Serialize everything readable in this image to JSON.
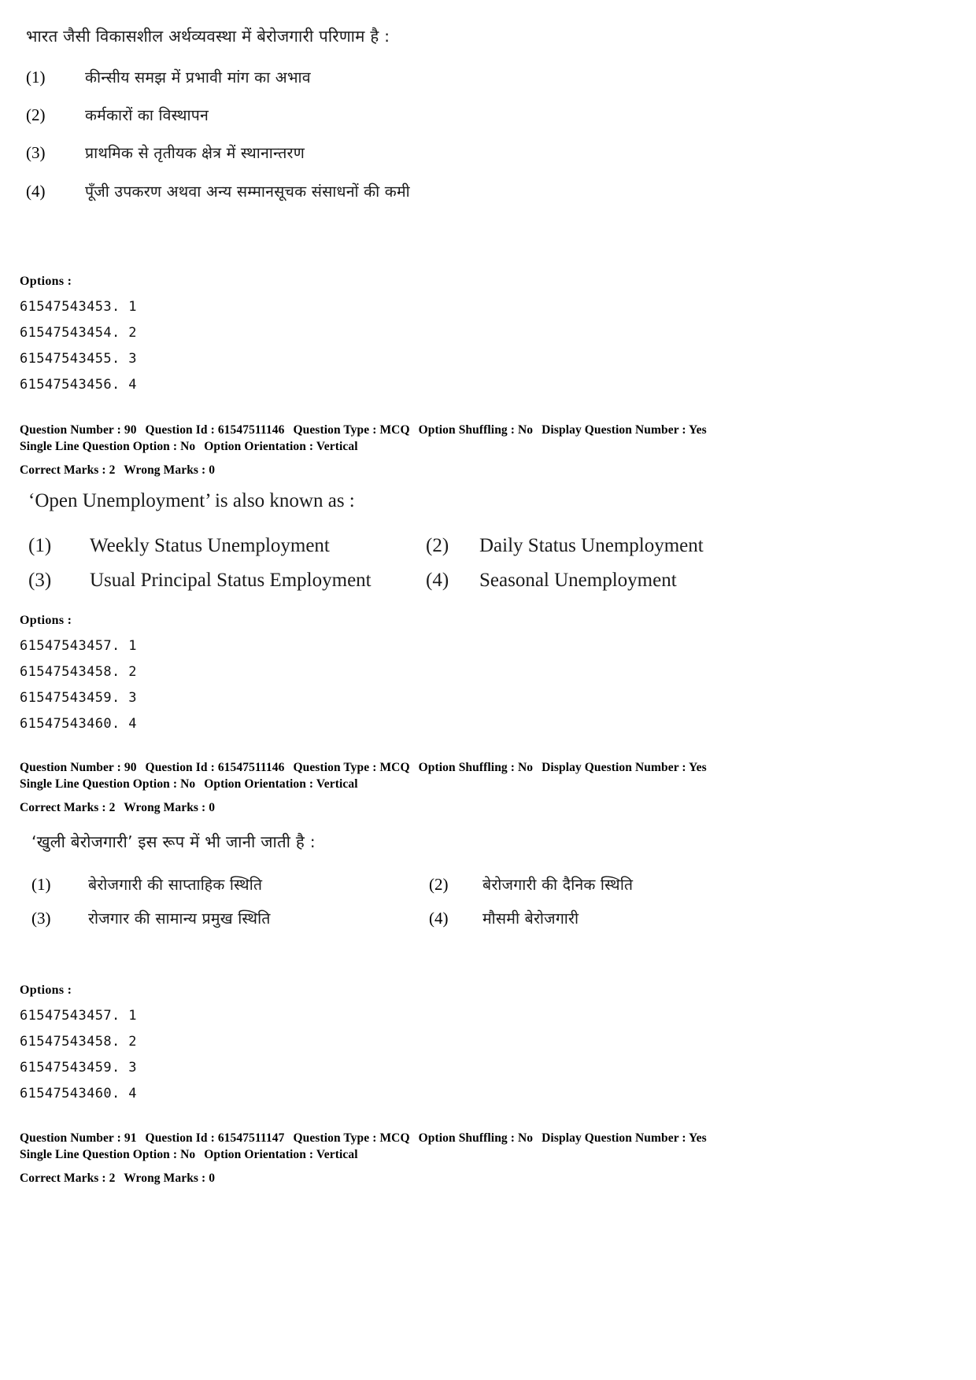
{
  "document": {
    "type": "exam-question-paper",
    "language_pairs": "Hindi / English"
  },
  "blocks": [
    {
      "id": "q90-hindi-first",
      "kind": "question",
      "script": "devanagari",
      "stem": "भारत जैसी विकासशील अर्थव्यवस्था में बेरोजगारी परिणाम है :",
      "layout": "vertical",
      "options": [
        {
          "num": "(1)",
          "text": "कीन्सीय समझ में प्रभावी मांग का अभाव"
        },
        {
          "num": "(2)",
          "text": "कर्मकारों का विस्थापन"
        },
        {
          "num": "(3)",
          "text": "प्राथमिक से तृतीयक क्षेत्र में स्थानान्तरण"
        },
        {
          "num": "(4)",
          "text": "पूँजी उपकरण अथवा अन्य सम्मानसूचक संसाधनों की कमी"
        }
      ],
      "options_label": "Options :",
      "option_ids": [
        "61547543453. 1",
        "61547543454. 2",
        "61547543455. 3",
        "61547543456. 4"
      ]
    },
    {
      "id": "q90-english",
      "kind": "question",
      "script": "latin",
      "stem": "‘Open Unemployment’ is also known as :",
      "layout": "two-column",
      "options": [
        {
          "num": "(1)",
          "text": "Weekly Status Unemployment"
        },
        {
          "num": "(2)",
          "text": "Daily Status Unemployment"
        },
        {
          "num": "(3)",
          "text": "Usual Principal Status Employment"
        },
        {
          "num": "(4)",
          "text": "Seasonal Unemployment"
        }
      ],
      "options_label": "Options :",
      "option_ids": [
        "61547543457. 1",
        "61547543458. 2",
        "61547543459. 3",
        "61547543460. 4"
      ]
    },
    {
      "id": "q90-hindi-second",
      "kind": "question",
      "script": "devanagari",
      "stem": "‘खुली बेरोजगारी’ इस रूप में भी जानी जाती है :",
      "layout": "two-column",
      "options": [
        {
          "num": "(1)",
          "text": "बेरोजगारी की साप्ताहिक स्थिति"
        },
        {
          "num": "(2)",
          "text": "बेरोजगारी की दैनिक स्थिति"
        },
        {
          "num": "(3)",
          "text": "रोजगार की सामान्य प्रमुख स्थिति"
        },
        {
          "num": "(4)",
          "text": "मौसमी बेरोजगारी"
        }
      ],
      "options_label": "Options :",
      "option_ids": [
        "61547543457. 1",
        "61547543458. 2",
        "61547543459. 3",
        "61547543460. 4"
      ]
    }
  ],
  "metadata_blocks": [
    {
      "id": "meta-after-q90-hindi",
      "line1": {
        "question_number_label": "Question Number :",
        "question_number": "90",
        "question_id_label": "Question Id :",
        "question_id": "61547511146",
        "question_type_label": "Question Type :",
        "question_type": "MCQ",
        "option_shuffling_label": "Option Shuffling :",
        "option_shuffling": "No",
        "display_question_number_label": "Display Question Number :",
        "display_question_number": "Yes"
      },
      "line2": {
        "single_line_question_option_label": "Single Line Question Option :",
        "single_line_question_option": "No",
        "option_orientation_label": "Option Orientation :",
        "option_orientation": "Vertical"
      },
      "line3": {
        "correct_marks_label": "Correct Marks :",
        "correct_marks": "2",
        "wrong_marks_label": "Wrong Marks :",
        "wrong_marks": "0"
      }
    },
    {
      "id": "meta-after-q90-english",
      "line1": {
        "question_number_label": "Question Number :",
        "question_number": "90",
        "question_id_label": "Question Id :",
        "question_id": "61547511146",
        "question_type_label": "Question Type :",
        "question_type": "MCQ",
        "option_shuffling_label": "Option Shuffling :",
        "option_shuffling": "No",
        "display_question_number_label": "Display Question Number :",
        "display_question_number": "Yes"
      },
      "line2": {
        "single_line_question_option_label": "Single Line Question Option :",
        "single_line_question_option": "No",
        "option_orientation_label": "Option Orientation :",
        "option_orientation": "Vertical"
      },
      "line3": {
        "correct_marks_label": "Correct Marks :",
        "correct_marks": "2",
        "wrong_marks_label": "Wrong Marks :",
        "wrong_marks": "0"
      }
    },
    {
      "id": "meta-after-q90-hindi-second",
      "line1": {
        "question_number_label": "Question Number :",
        "question_number": "91",
        "question_id_label": "Question Id :",
        "question_id": "61547511147",
        "question_type_label": "Question Type :",
        "question_type": "MCQ",
        "option_shuffling_label": "Option Shuffling :",
        "option_shuffling": "No",
        "display_question_number_label": "Display Question Number :",
        "display_question_number": "Yes"
      },
      "line2": {
        "single_line_question_option_label": "Single Line Question Option :",
        "single_line_question_option": "No",
        "option_orientation_label": "Option Orientation :",
        "option_orientation": "Vertical"
      },
      "line3": {
        "correct_marks_label": "Correct Marks :",
        "correct_marks": "2",
        "wrong_marks_label": "Wrong Marks :",
        "wrong_marks": "0"
      }
    }
  ]
}
